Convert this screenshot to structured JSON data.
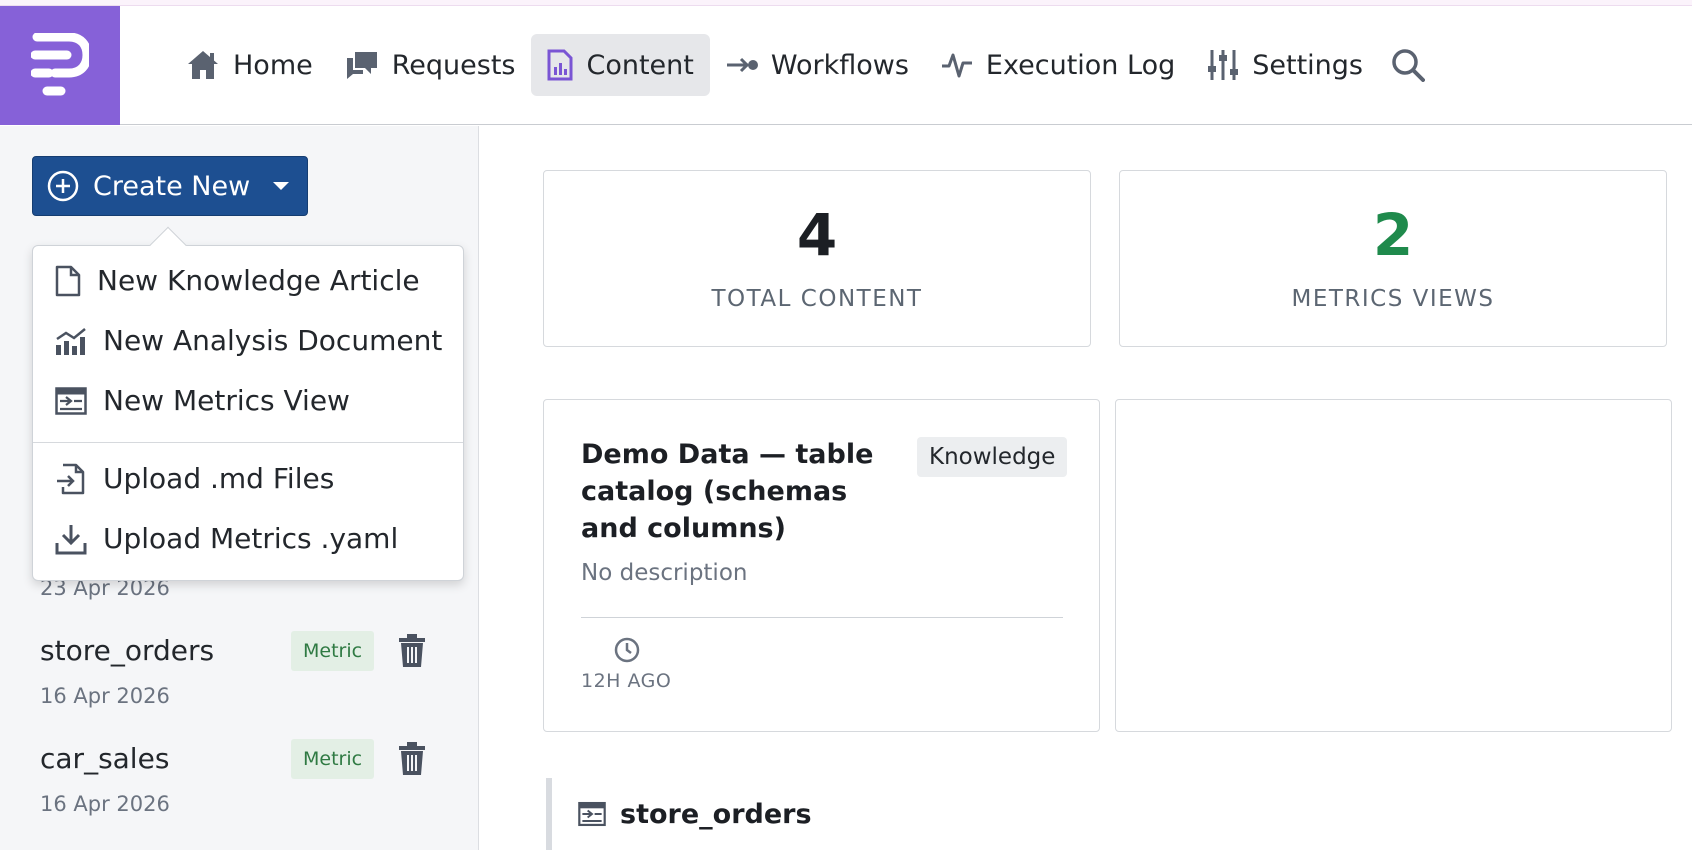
{
  "nav": {
    "items": [
      {
        "label": "Home",
        "icon": "home-icon"
      },
      {
        "label": "Requests",
        "icon": "chat-bubbles-icon"
      },
      {
        "label": "Content",
        "icon": "document-chart-icon",
        "active": true
      },
      {
        "label": "Workflows",
        "icon": "workflow-arrow-icon"
      },
      {
        "label": "Execution Log",
        "icon": "pulse-icon"
      },
      {
        "label": "Settings",
        "icon": "sliders-icon"
      }
    ],
    "search_icon": "search-icon",
    "active_bg": "#e6e7ea",
    "logo_bg": "#8661d8"
  },
  "sidebar": {
    "create_label": "Create New",
    "create_bg": "#1d4f91",
    "partial_date": "23 Apr 2026",
    "items": [
      {
        "title": "store_orders",
        "badge": "Metric",
        "date": "16 Apr 2026"
      },
      {
        "title": "car_sales",
        "badge": "Metric",
        "date": "16 Apr 2026"
      }
    ]
  },
  "dropdown": {
    "items": [
      {
        "label": "New Knowledge Article",
        "icon": "file-icon"
      },
      {
        "label": "New Analysis Document",
        "icon": "chart-line-icon"
      },
      {
        "label": "New Metrics View",
        "icon": "metrics-view-icon"
      },
      {
        "label": "Upload .md Files",
        "icon": "file-import-icon"
      },
      {
        "label": "Upload Metrics .yaml",
        "icon": "download-icon"
      }
    ]
  },
  "stats": [
    {
      "value": "4",
      "label": "TOTAL CONTENT",
      "color": "#1c1f24"
    },
    {
      "value": "2",
      "label": "METRICS VIEWS",
      "color": "#1f8a4c"
    }
  ],
  "card": {
    "title": "Demo Data — table catalog (schemas and columns)",
    "badge": "Knowledge",
    "description": "No description",
    "time": "12H AGO"
  },
  "bottom": {
    "title": "store_orders"
  }
}
